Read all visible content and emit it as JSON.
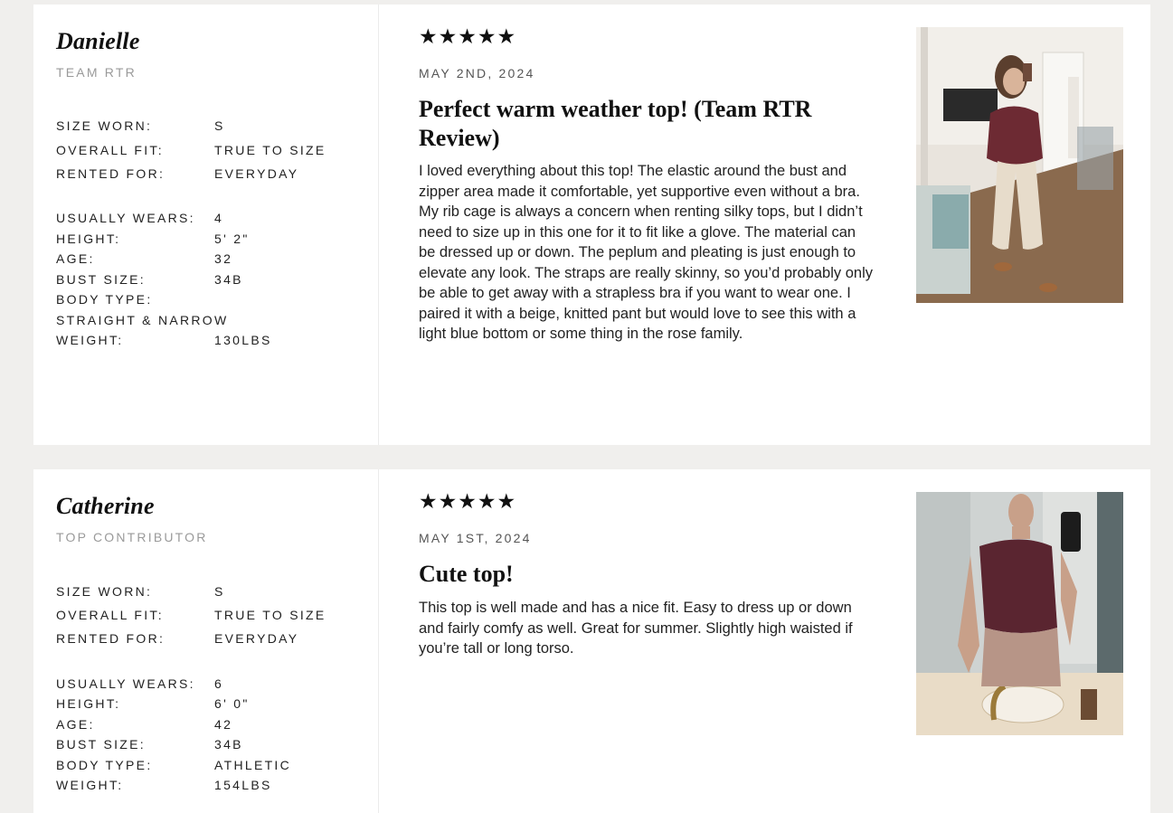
{
  "reviews": [
    {
      "reviewer": {
        "name": "Danielle",
        "role": "TEAM RTR",
        "size_worn_label": "SIZE WORN:",
        "size_worn": "S",
        "overall_fit_label": "OVERALL FIT:",
        "overall_fit": "TRUE TO SIZE",
        "rented_for_label": "RENTED FOR:",
        "rented_for": "EVERYDAY",
        "usually_wears_label": "USUALLY WEARS:",
        "usually_wears": "4",
        "height_label": "HEIGHT:",
        "height": "5' 2\"",
        "age_label": "AGE:",
        "age": "32",
        "bust_size_label": "BUST SIZE:",
        "bust_size": "34B",
        "body_type_label": "BODY TYPE:",
        "body_type": "STRAIGHT & NARROW",
        "weight_label": "WEIGHT:",
        "weight": "130LBS"
      },
      "stars": "★★★★★",
      "rating": 5,
      "date": "MAY 2ND, 2024",
      "title": "Perfect warm weather top! (Team RTR Review)",
      "body": "I loved everything about this top! The elastic around the bust and zipper area made it comfortable, yet supportive even without a bra. My rib cage is always a concern when renting silky tops, but I didn’t need to size up in this one for it to fit like a glove. The material can be dressed up or down. The peplum and pleating is just enough to elevate any look. The straps are really skinny, so you’d probably only be able to get away with a strapless bra if you want to wear one. I paired it with a beige, knitted pant but would love to see this with a light blue bottom or some thing in the rose family."
    },
    {
      "reviewer": {
        "name": "Catherine",
        "role": "TOP CONTRIBUTOR",
        "size_worn_label": "SIZE WORN:",
        "size_worn": "S",
        "overall_fit_label": "OVERALL FIT:",
        "overall_fit": "TRUE TO SIZE",
        "rented_for_label": "RENTED FOR:",
        "rented_for": "EVERYDAY",
        "usually_wears_label": "USUALLY WEARS:",
        "usually_wears": "6",
        "height_label": "HEIGHT:",
        "height": "6' 0\"",
        "age_label": "AGE:",
        "age": "42",
        "bust_size_label": "BUST SIZE:",
        "bust_size": "34B",
        "body_type_label": "BODY TYPE:",
        "body_type": "ATHLETIC",
        "weight_label": "WEIGHT:",
        "weight": "154LBS"
      },
      "stars": "★★★★★",
      "rating": 5,
      "date": "MAY 1ST, 2024",
      "title": "Cute top!",
      "body": "This top is well made and has a nice fit. Easy to dress up or down and fairly comfy as well. Great for summer. Slightly high waisted if you’re tall or long torso."
    }
  ]
}
